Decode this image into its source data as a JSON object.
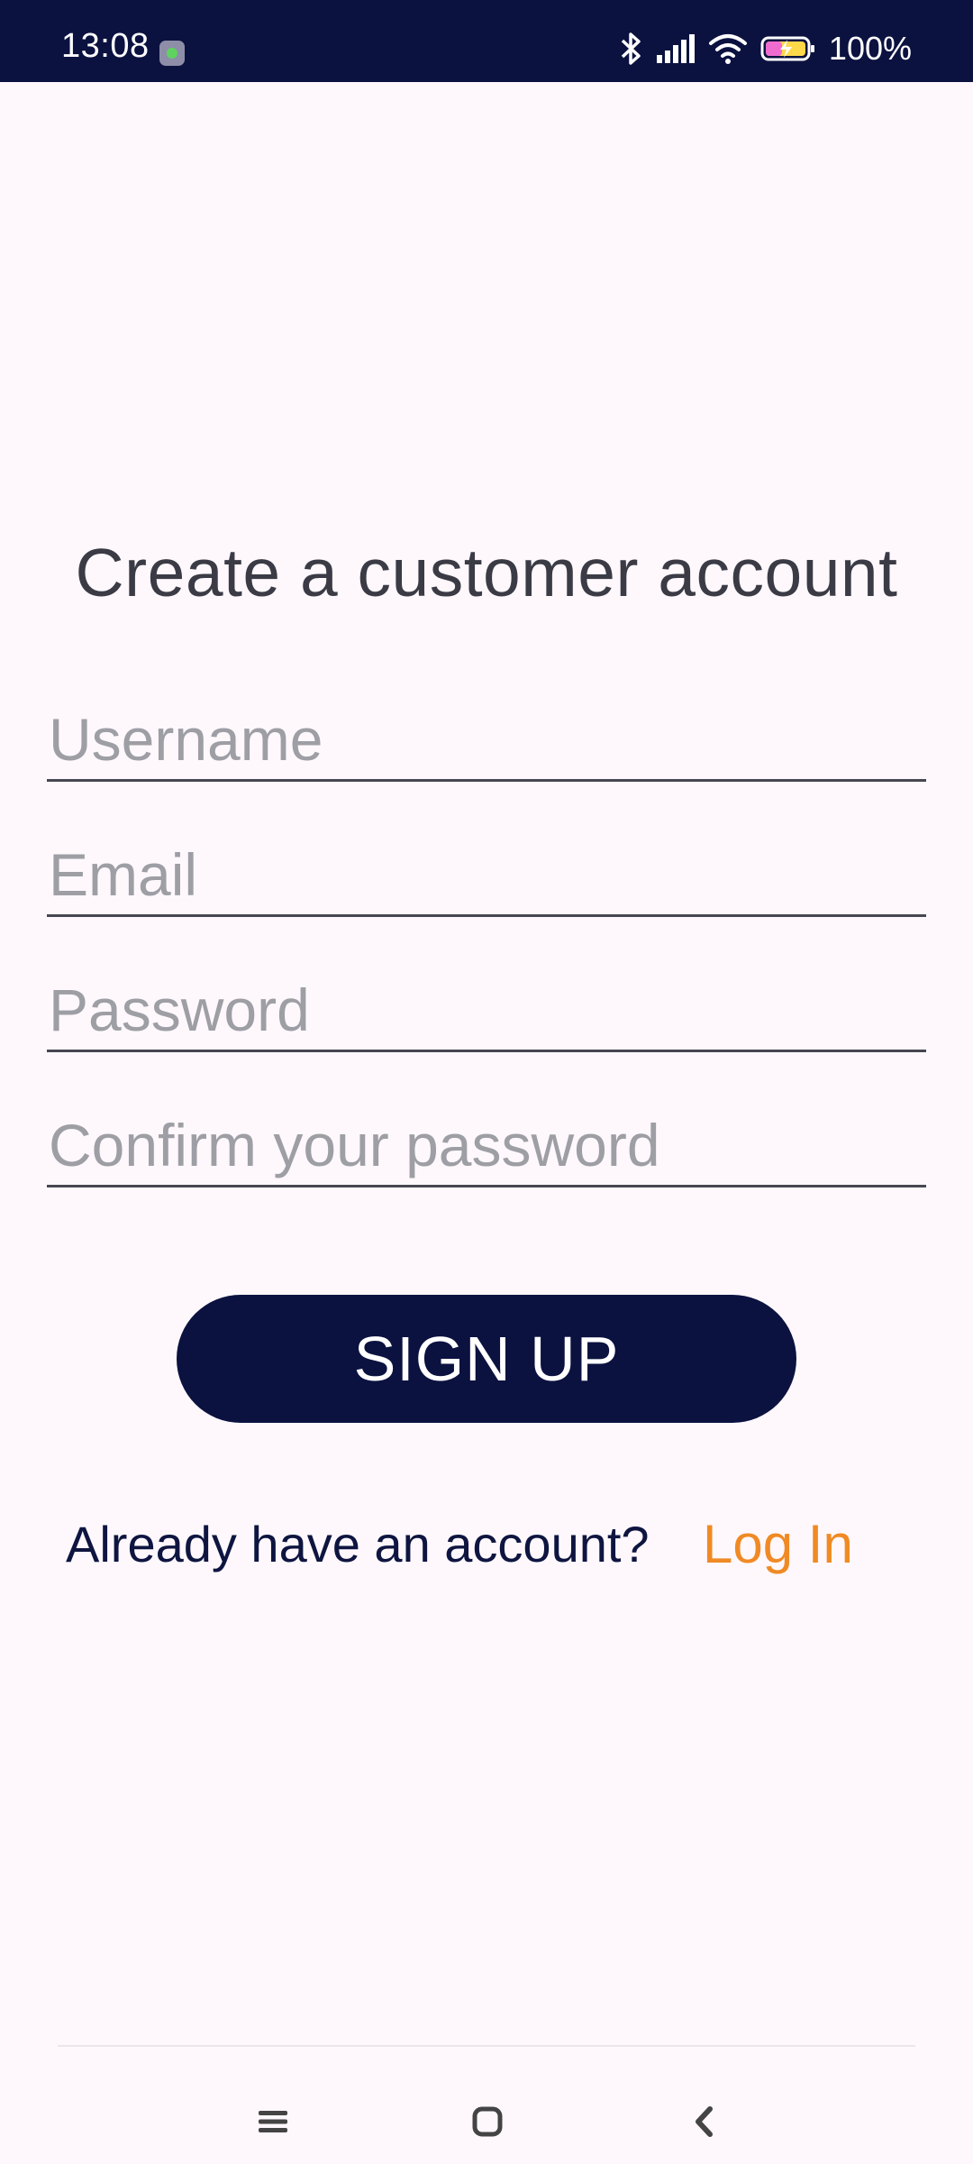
{
  "status_bar": {
    "time": "13:08",
    "battery": "100%",
    "icons": [
      "app-notification-icon",
      "bluetooth-icon",
      "signal-icon",
      "wifi-icon",
      "battery-charging-icon"
    ]
  },
  "signup": {
    "title": "Create a customer account",
    "username_placeholder": "Username",
    "email_placeholder": "Email",
    "password_placeholder": "Password",
    "confirm_placeholder": "Confirm your password",
    "button_label": "SIGN UP",
    "already_text": "Already have an account?",
    "login_label": "Log In"
  },
  "nav": {
    "icons": [
      "menu-icon",
      "home-icon",
      "back-icon"
    ]
  },
  "colors": {
    "brand_dark": "#0b1240",
    "accent": "#f08a24",
    "background": "#fef8fc"
  }
}
